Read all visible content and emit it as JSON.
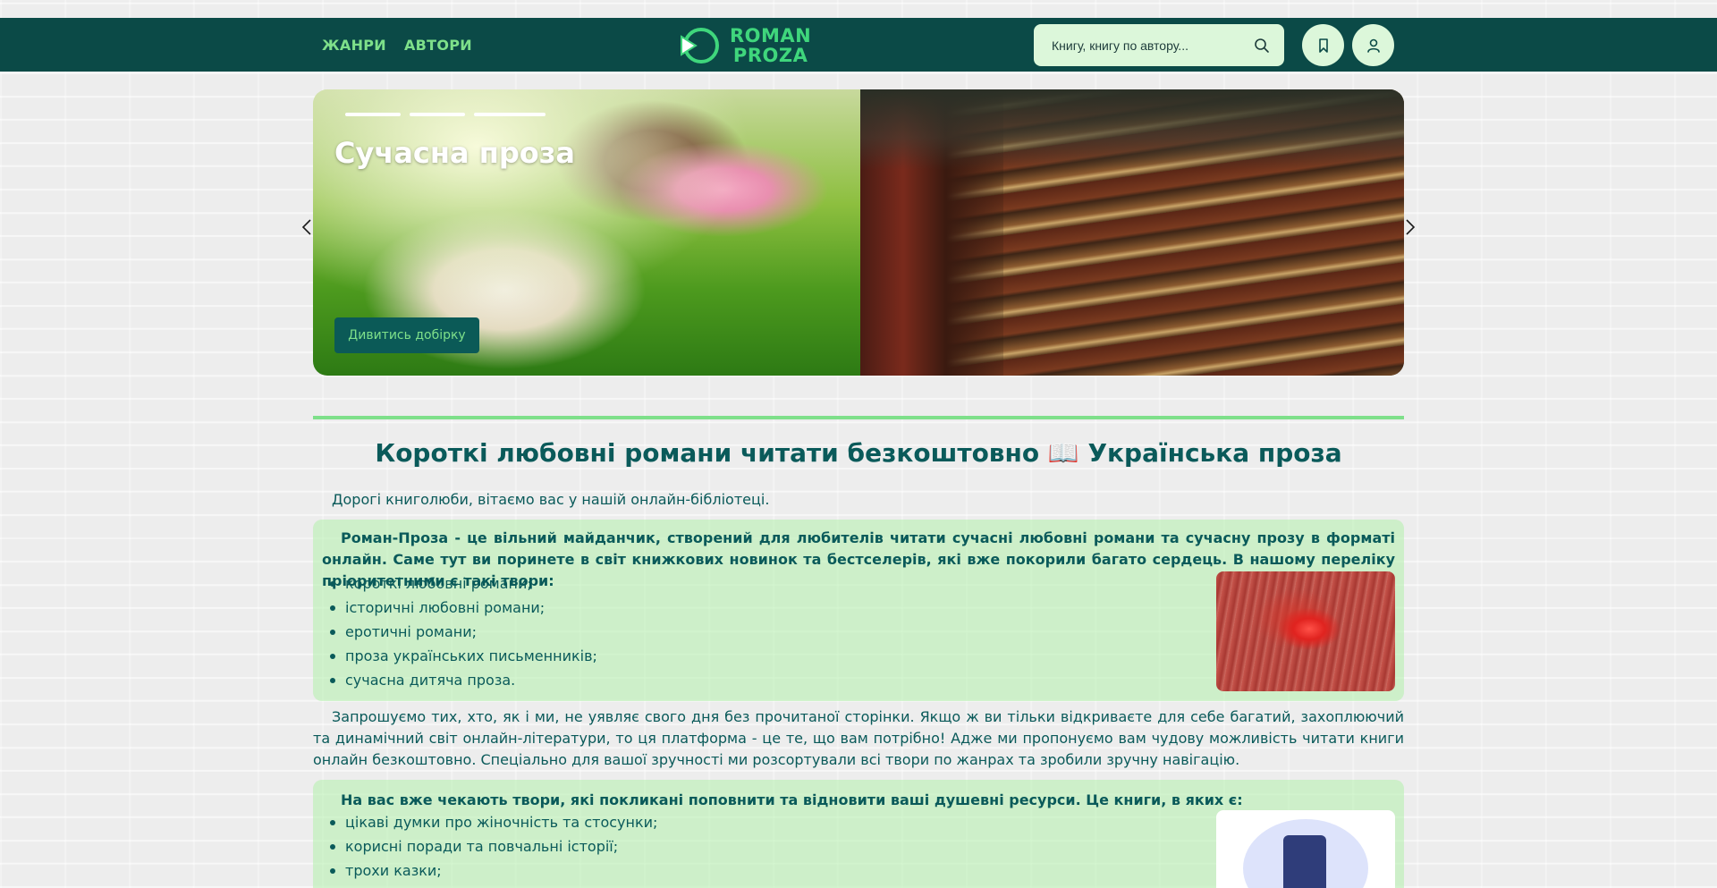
{
  "header": {
    "nav": [
      "ЖАНРИ",
      "АВТОРИ"
    ],
    "logo_line1": "ROMAN",
    "logo_line2": "PROZA",
    "search_placeholder": "Книгу, книгу по автору...",
    "bookmark_icon": "bookmark-icon",
    "user_icon": "user-icon",
    "search_icon": "search-icon"
  },
  "hero": {
    "title": "Сучасна проза",
    "button": "Дивитись добірку",
    "slide_count": 3
  },
  "main": {
    "title": "Короткі любовні романи читати безкоштовно 📖 Українська проза",
    "greeting": "Дорогі книголюби, вітаємо вас у нашій онлайн-бібліотеці.",
    "box1": {
      "lead": "Роман-Проза - це вільний майданчик, створений для любителів читати сучасні любовні романи та сучасну прозу в форматі онлайн. Саме тут ви поринете в світ книжкових новинок та бестселерів, які вже покорили багато сердець. В нашому переліку пріоритетними є такі твори:",
      "items": [
        "короткі любовні романи;",
        "історичні любовні романи;",
        "еротичні романи;",
        "проза українських письменників;",
        "сучасна дитяча проза."
      ]
    },
    "paragraph": "Запрошуємо тих, хто, як і ми, не уявляє свого дня без прочитаної сторінки. Якщо ж ви тільки відкриваєте для себе багатий, захоплюючий та динамічний світ онлайн-літератури, то ця платформа - це те, що вам потрібно! Адже ми пропонуємо вам чудову можливість читати книги онлайн безкоштовно. Спеціально для вашої зручності ми розсортували всі твори по жанрах та зробили зручну навігацію.",
    "box2": {
      "lead": "На вас вже чекають твори, які покликані поповнити та відновити ваші душевні ресурси. Це книги, в яких є:",
      "items": [
        "цікаві думки про жіночність та стосунки;",
        "корисні поради та повчальні історії;",
        "трохи казки;"
      ]
    }
  },
  "colors": {
    "header_bg": "#0b4a47",
    "accent_green": "#7ee08a",
    "text_teal": "#0a5a5a",
    "panel_green": "#b2f0ac"
  }
}
